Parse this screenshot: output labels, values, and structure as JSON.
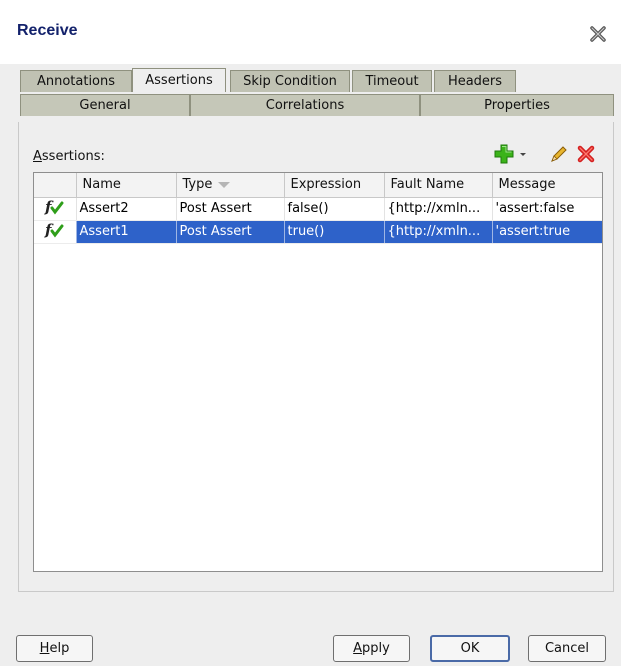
{
  "dialog": {
    "title": "Receive"
  },
  "tabs": {
    "row1": [
      {
        "label": "Annotations"
      },
      {
        "label": "Assertions",
        "active": true
      },
      {
        "label": "Skip Condition"
      },
      {
        "label": "Timeout"
      },
      {
        "label": "Headers"
      }
    ],
    "row2": [
      {
        "label": "General"
      },
      {
        "label": "Correlations"
      },
      {
        "label": "Properties"
      }
    ]
  },
  "assertions": {
    "label_mnemonic": "A",
    "label_rest": "ssertions:",
    "toolbar": {
      "add_icon": "add-plus-icon",
      "dropdown_icon": "chevron-down-icon",
      "edit_icon": "pencil-icon",
      "delete_icon": "delete-x-icon"
    },
    "columns": [
      "",
      "Name",
      "Type",
      "Expression",
      "Fault Name",
      "Message"
    ],
    "rows": [
      {
        "icon": "function-check-icon",
        "name": "Assert2",
        "type": "Post Assert",
        "expression": "false()",
        "fault_name": "{http://xmln...",
        "message": "'assert:false",
        "selected": false
      },
      {
        "icon": "function-check-icon",
        "name": "Assert1",
        "type": "Post Assert",
        "expression": "true()",
        "fault_name": "{http://xmln...",
        "message": "'assert:true",
        "selected": true
      }
    ]
  },
  "buttons": {
    "help_mnemonic": "H",
    "help_rest": "elp",
    "apply_mnemonic": "A",
    "apply_rest": "pply",
    "ok": "OK",
    "cancel": "Cancel"
  },
  "colors": {
    "title": "#12216b",
    "selection": "#2e62c9",
    "tab_bg": "#c0c2b3",
    "add_green": "#3bb319",
    "delete_red": "#d42020"
  }
}
